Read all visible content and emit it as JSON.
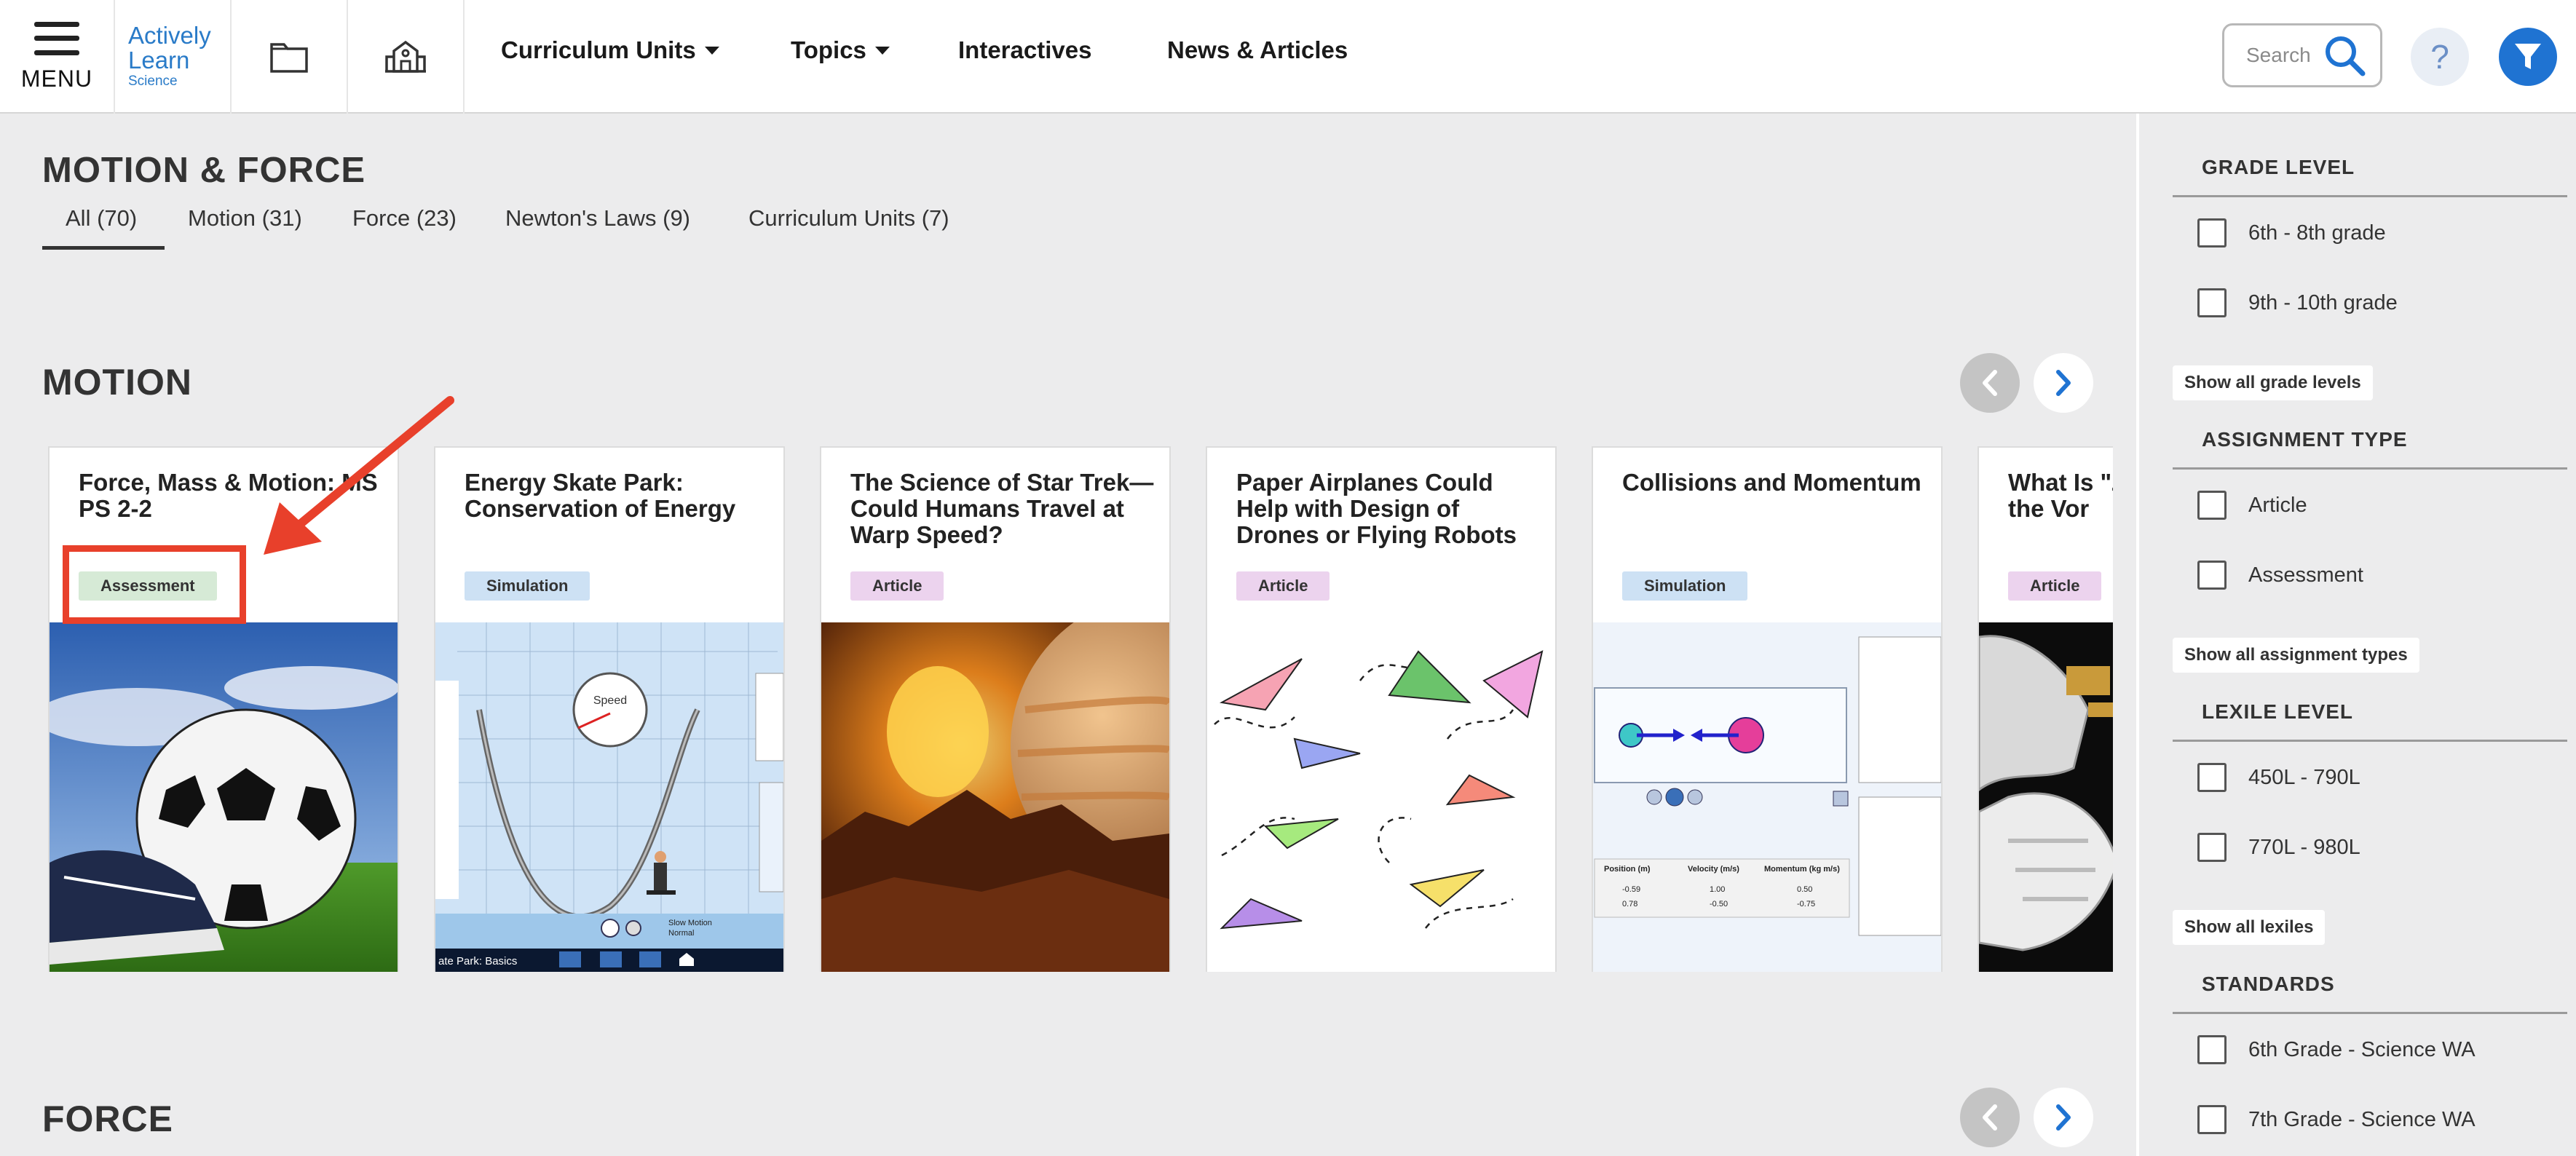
{
  "header": {
    "menu_label": "MENU",
    "logo": {
      "line1": "Actively",
      "line2": "Learn",
      "line3": "Science"
    },
    "nav": [
      {
        "label": "Curriculum Units",
        "has_caret": true
      },
      {
        "label": "Topics",
        "has_caret": true
      },
      {
        "label": "Interactives",
        "has_caret": false
      },
      {
        "label": "News & Articles",
        "has_caret": false
      }
    ],
    "search_placeholder": "Search",
    "help_label": "?"
  },
  "page": {
    "title": "MOTION & FORCE",
    "tabs": [
      {
        "label": "All (70)",
        "active": true
      },
      {
        "label": "Motion (31)",
        "active": false
      },
      {
        "label": "Force (23)",
        "active": false
      },
      {
        "label": "Newton's Laws (9)",
        "active": false
      },
      {
        "label": "Curriculum Units (7)",
        "active": false
      }
    ]
  },
  "sections": [
    {
      "title": "MOTION",
      "cards": [
        {
          "title": "Force, Mass & Motion: MS PS 2-2",
          "type": "Assessment",
          "image": "soccer-ball"
        },
        {
          "title": "Energy Skate Park: Conservation of Energy",
          "type": "Simulation",
          "image": "skate-park-simulation",
          "speed_label": "Speed",
          "sim_caption": "ate Park: Basics",
          "sim_option1": "Slow Motion",
          "sim_option2": "Normal"
        },
        {
          "title": "The Science of Star Trek—Could Humans Travel at Warp Speed?",
          "type": "Article",
          "image": "volcano-planet"
        },
        {
          "title": "Paper Airplanes Could Help with Design of Drones or Flying Robots",
          "type": "Article",
          "image": "paper-airplanes"
        },
        {
          "title": "Collisions and Momentum",
          "type": "Simulation",
          "image": "collision-simulation",
          "table_headers": [
            "Position (m)",
            "Velocity (m/s)",
            "Momentum (kg m/s)"
          ],
          "table_rows": [
            [
              "-0.59",
              "1.00",
              "0.50"
            ],
            [
              "0.78",
              "-0.50",
              "-0.75"
            ]
          ]
        },
        {
          "title": "What Is \"Z That Peop in the Vor",
          "type": "Article",
          "image": "astronaut-suit"
        }
      ]
    },
    {
      "title": "FORCE",
      "cards": []
    }
  ],
  "filters": {
    "groups": [
      {
        "title": "GRADE LEVEL",
        "items": [
          "6th - 8th grade",
          "9th - 10th grade"
        ],
        "show_all": "Show all grade levels"
      },
      {
        "title": "ASSIGNMENT TYPE",
        "items": [
          "Article",
          "Assessment"
        ],
        "show_all": "Show all assignment types"
      },
      {
        "title": "LEXILE LEVEL",
        "items": [
          "450L - 790L",
          "770L - 980L"
        ],
        "show_all": "Show all lexiles"
      },
      {
        "title": "STANDARDS",
        "items": [
          "6th Grade - Science WA",
          "7th Grade - Science WA"
        ],
        "show_all": ""
      }
    ]
  },
  "colors": {
    "accent_blue": "#1f73d2",
    "highlight_red": "#e8402b",
    "assessment_badge": "#d6ead6",
    "simulation_badge": "#cde1f4",
    "article_badge": "#ecd3ee"
  }
}
